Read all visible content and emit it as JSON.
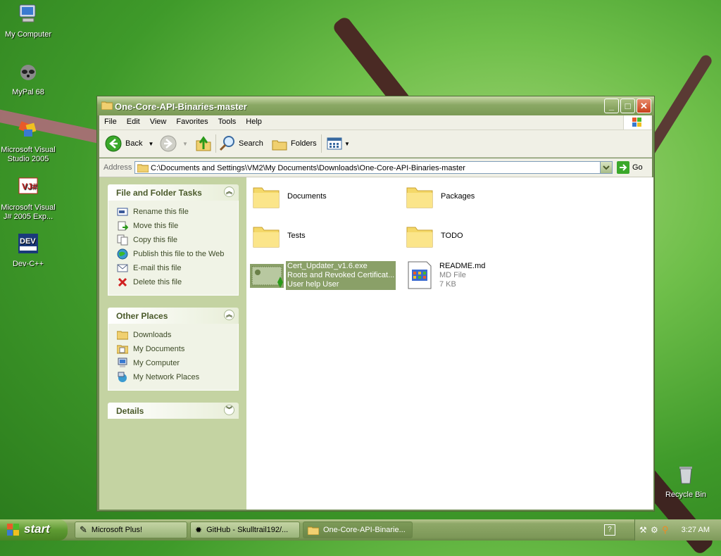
{
  "desktop": {
    "icons": [
      {
        "label": "My Computer"
      },
      {
        "label": "MyPal 68"
      },
      {
        "label": "Microsoft Visual Studio 2005"
      },
      {
        "label": "Microsoft Visual J# 2005 Exp..."
      },
      {
        "label": "Dev-C++"
      },
      {
        "label": "Recycle Bin"
      }
    ]
  },
  "window": {
    "title": "One-Core-API-Binaries-master",
    "menu": [
      "File",
      "Edit",
      "View",
      "Favorites",
      "Tools",
      "Help"
    ],
    "toolbar": {
      "back": "Back",
      "search": "Search",
      "folders": "Folders"
    },
    "address": {
      "label": "Address",
      "path": "C:\\Documents and Settings\\VM2\\My Documents\\Downloads\\One-Core-API-Binaries-master",
      "go": "Go"
    },
    "file_tasks": {
      "title": "File and Folder Tasks",
      "items": [
        "Rename this file",
        "Move this file",
        "Copy this file",
        "Publish this file to the Web",
        "E-mail this file",
        "Delete this file"
      ]
    },
    "other_places": {
      "title": "Other Places",
      "items": [
        "Downloads",
        "My Documents",
        "My Computer",
        "My Network Places"
      ]
    },
    "details": {
      "title": "Details"
    },
    "items": [
      {
        "name": "Documents"
      },
      {
        "name": "Packages"
      },
      {
        "name": "Tests"
      },
      {
        "name": "TODO"
      },
      {
        "name": "Cert_Updater_v1.6.exe",
        "line2": "Roots and Revoked Certificat...",
        "line3": "User help User"
      },
      {
        "name": "README.md",
        "line2": "MD File",
        "line3": "7 KB"
      }
    ]
  },
  "taskbar": {
    "start": "start",
    "tasks": [
      "Microsoft Plus!",
      "GitHub - Skulltrail192/...",
      "One-Core-API-Binarie..."
    ],
    "clock": "3:27 AM"
  },
  "colors": {
    "accent": "#7b9a56",
    "panel": "#c4d3a2",
    "selection": "#8aa068"
  }
}
